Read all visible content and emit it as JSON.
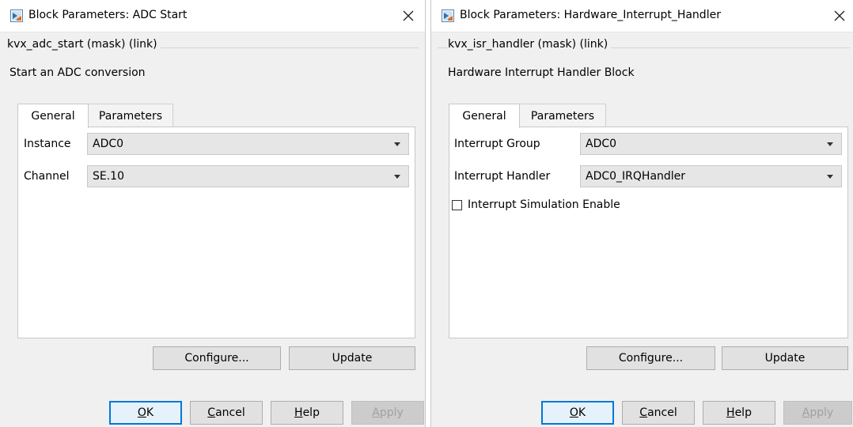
{
  "dialogs": [
    {
      "title": "Block Parameters: ADC Start",
      "group_label": "kvx_adc_start (mask) (link)",
      "description": "Start an ADC conversion",
      "tabs": [
        "General",
        "Parameters"
      ],
      "fields": [
        {
          "label": "Instance",
          "value": "ADC0"
        },
        {
          "label": "Channel",
          "value": "SE.10"
        }
      ],
      "panel_buttons": {
        "configure": "Configure...",
        "update": "Update"
      },
      "footer": {
        "ok": {
          "mnemonic": "O",
          "rest": "K"
        },
        "cancel": {
          "mnemonic": "C",
          "rest": "ancel"
        },
        "help": {
          "mnemonic": "H",
          "rest": "elp"
        },
        "apply": {
          "mnemonic": "A",
          "rest": "pply"
        }
      }
    },
    {
      "title": "Block Parameters: Hardware_Interrupt_Handler",
      "group_label": "kvx_isr_handler (mask) (link)",
      "description": "Hardware Interrupt Handler Block",
      "tabs": [
        "General",
        "Parameters"
      ],
      "fields": [
        {
          "label": "Interrupt Group",
          "value": "ADC0"
        },
        {
          "label": "Interrupt Handler",
          "value": "ADC0_IRQHandler"
        }
      ],
      "checkbox": {
        "label": "Interrupt Simulation Enable",
        "checked": false
      },
      "panel_buttons": {
        "configure": "Configure...",
        "update": "Update"
      },
      "footer": {
        "ok": {
          "mnemonic": "O",
          "rest": "K"
        },
        "cancel": {
          "mnemonic": "C",
          "rest": "ancel"
        },
        "help": {
          "mnemonic": "H",
          "rest": "elp"
        },
        "apply": {
          "mnemonic": "A",
          "rest": "pply"
        }
      }
    }
  ],
  "icons": {
    "app": "simulink-icon",
    "close": "close-icon",
    "dropdown": "chevron-down-icon"
  },
  "colors": {
    "focus_border": "#0078d7",
    "disabled_text": "#a0a0a0"
  }
}
